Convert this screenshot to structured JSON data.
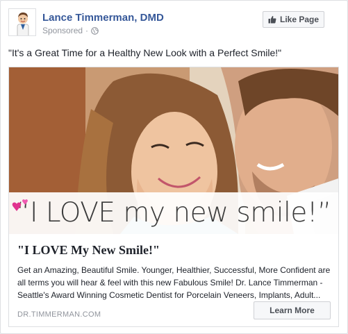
{
  "header": {
    "page_name": "Lance Timmerman, DMD",
    "sponsored": "Sponsored",
    "separator": "·",
    "like_button": "Like Page"
  },
  "post_text": "\"It's a Great Time for a Healthy New Look with a Perfect Smile!\"",
  "attachment": {
    "image_overlay_text": "“I LOVE my new smile!”",
    "headline": "\"I LOVE My New Smile!\"",
    "description": "Get an Amazing, Beautiful Smile. Younger, Healthier, Successful, More Confident are all terms you will hear & feel with this new Fabulous Smile! Dr. Lance Timmerman - Seattle's Award Winning Cosmetic Dentist for Porcelain Veneers, Implants, Adult...",
    "domain": "DR.TIMMERMAN.COM",
    "cta": "Learn More"
  },
  "icons": {
    "avatar": "dentist-cartoon-icon",
    "privacy": "globe-icon",
    "like": "thumbs-up-icon",
    "decoration": "pink-hearts-icon"
  },
  "colors": {
    "page_name": "#365899",
    "hearts": "#e0338f",
    "muted_text": "#90949c"
  }
}
